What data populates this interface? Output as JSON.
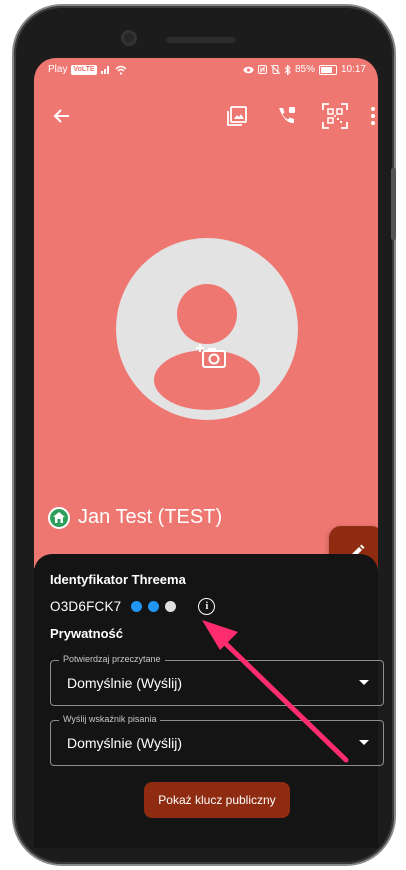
{
  "status_bar": {
    "carrier": "Play",
    "carrier_badge": "VoLTE",
    "battery": "85%",
    "time": "10:17"
  },
  "toolbar": {
    "icons": [
      "arrow-back-icon",
      "gallery-icon",
      "call-settings-icon",
      "qr-code-icon",
      "more-vert-icon"
    ]
  },
  "contact": {
    "name": "Jan Test (TEST)"
  },
  "identity": {
    "title": "Identyfikator Threema",
    "id": "O3D6FCK7",
    "verification_colors": [
      "#2196f3",
      "#2196f3",
      "#e0e0e0"
    ]
  },
  "privacy": {
    "title": "Prywatność",
    "read_receipts": {
      "label": "Potwierdzaj przeczytane",
      "value": "Domyślnie (Wyślij)"
    },
    "typing_indicator": {
      "label": "Wyślij wskaźnik pisania",
      "value": "Domyślnie (Wyślij)"
    }
  },
  "actions": {
    "show_public_key": "Pokaż klucz publiczny"
  },
  "colors": {
    "header_bg": "#ef7772",
    "accent": "#8e2b10",
    "sheet_bg": "#141414",
    "annotation_arrow": "#ff2d6f"
  }
}
